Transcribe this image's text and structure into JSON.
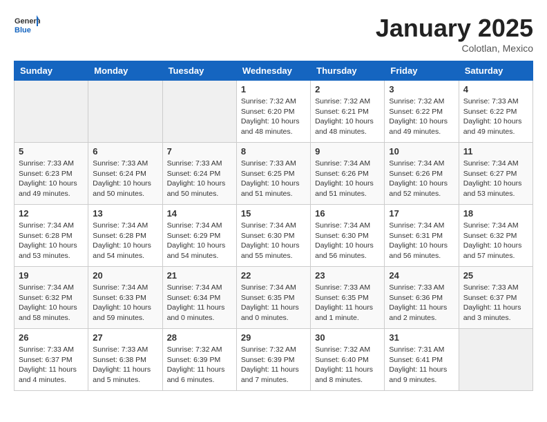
{
  "header": {
    "logo": {
      "general": "General",
      "blue": "Blue"
    },
    "month": "January 2025",
    "location": "Colotlan, Mexico"
  },
  "weekdays": [
    "Sunday",
    "Monday",
    "Tuesday",
    "Wednesday",
    "Thursday",
    "Friday",
    "Saturday"
  ],
  "weeks": [
    [
      {
        "day": "",
        "info": ""
      },
      {
        "day": "",
        "info": ""
      },
      {
        "day": "",
        "info": ""
      },
      {
        "day": "1",
        "info": "Sunrise: 7:32 AM\nSunset: 6:20 PM\nDaylight: 10 hours\nand 48 minutes."
      },
      {
        "day": "2",
        "info": "Sunrise: 7:32 AM\nSunset: 6:21 PM\nDaylight: 10 hours\nand 48 minutes."
      },
      {
        "day": "3",
        "info": "Sunrise: 7:32 AM\nSunset: 6:22 PM\nDaylight: 10 hours\nand 49 minutes."
      },
      {
        "day": "4",
        "info": "Sunrise: 7:33 AM\nSunset: 6:22 PM\nDaylight: 10 hours\nand 49 minutes."
      }
    ],
    [
      {
        "day": "5",
        "info": "Sunrise: 7:33 AM\nSunset: 6:23 PM\nDaylight: 10 hours\nand 49 minutes."
      },
      {
        "day": "6",
        "info": "Sunrise: 7:33 AM\nSunset: 6:24 PM\nDaylight: 10 hours\nand 50 minutes."
      },
      {
        "day": "7",
        "info": "Sunrise: 7:33 AM\nSunset: 6:24 PM\nDaylight: 10 hours\nand 50 minutes."
      },
      {
        "day": "8",
        "info": "Sunrise: 7:33 AM\nSunset: 6:25 PM\nDaylight: 10 hours\nand 51 minutes."
      },
      {
        "day": "9",
        "info": "Sunrise: 7:34 AM\nSunset: 6:26 PM\nDaylight: 10 hours\nand 51 minutes."
      },
      {
        "day": "10",
        "info": "Sunrise: 7:34 AM\nSunset: 6:26 PM\nDaylight: 10 hours\nand 52 minutes."
      },
      {
        "day": "11",
        "info": "Sunrise: 7:34 AM\nSunset: 6:27 PM\nDaylight: 10 hours\nand 53 minutes."
      }
    ],
    [
      {
        "day": "12",
        "info": "Sunrise: 7:34 AM\nSunset: 6:28 PM\nDaylight: 10 hours\nand 53 minutes."
      },
      {
        "day": "13",
        "info": "Sunrise: 7:34 AM\nSunset: 6:28 PM\nDaylight: 10 hours\nand 54 minutes."
      },
      {
        "day": "14",
        "info": "Sunrise: 7:34 AM\nSunset: 6:29 PM\nDaylight: 10 hours\nand 54 minutes."
      },
      {
        "day": "15",
        "info": "Sunrise: 7:34 AM\nSunset: 6:30 PM\nDaylight: 10 hours\nand 55 minutes."
      },
      {
        "day": "16",
        "info": "Sunrise: 7:34 AM\nSunset: 6:30 PM\nDaylight: 10 hours\nand 56 minutes."
      },
      {
        "day": "17",
        "info": "Sunrise: 7:34 AM\nSunset: 6:31 PM\nDaylight: 10 hours\nand 56 minutes."
      },
      {
        "day": "18",
        "info": "Sunrise: 7:34 AM\nSunset: 6:32 PM\nDaylight: 10 hours\nand 57 minutes."
      }
    ],
    [
      {
        "day": "19",
        "info": "Sunrise: 7:34 AM\nSunset: 6:32 PM\nDaylight: 10 hours\nand 58 minutes."
      },
      {
        "day": "20",
        "info": "Sunrise: 7:34 AM\nSunset: 6:33 PM\nDaylight: 10 hours\nand 59 minutes."
      },
      {
        "day": "21",
        "info": "Sunrise: 7:34 AM\nSunset: 6:34 PM\nDaylight: 11 hours\nand 0 minutes."
      },
      {
        "day": "22",
        "info": "Sunrise: 7:34 AM\nSunset: 6:35 PM\nDaylight: 11 hours\nand 0 minutes."
      },
      {
        "day": "23",
        "info": "Sunrise: 7:33 AM\nSunset: 6:35 PM\nDaylight: 11 hours\nand 1 minute."
      },
      {
        "day": "24",
        "info": "Sunrise: 7:33 AM\nSunset: 6:36 PM\nDaylight: 11 hours\nand 2 minutes."
      },
      {
        "day": "25",
        "info": "Sunrise: 7:33 AM\nSunset: 6:37 PM\nDaylight: 11 hours\nand 3 minutes."
      }
    ],
    [
      {
        "day": "26",
        "info": "Sunrise: 7:33 AM\nSunset: 6:37 PM\nDaylight: 11 hours\nand 4 minutes."
      },
      {
        "day": "27",
        "info": "Sunrise: 7:33 AM\nSunset: 6:38 PM\nDaylight: 11 hours\nand 5 minutes."
      },
      {
        "day": "28",
        "info": "Sunrise: 7:32 AM\nSunset: 6:39 PM\nDaylight: 11 hours\nand 6 minutes."
      },
      {
        "day": "29",
        "info": "Sunrise: 7:32 AM\nSunset: 6:39 PM\nDaylight: 11 hours\nand 7 minutes."
      },
      {
        "day": "30",
        "info": "Sunrise: 7:32 AM\nSunset: 6:40 PM\nDaylight: 11 hours\nand 8 minutes."
      },
      {
        "day": "31",
        "info": "Sunrise: 7:31 AM\nSunset: 6:41 PM\nDaylight: 11 hours\nand 9 minutes."
      },
      {
        "day": "",
        "info": ""
      }
    ]
  ]
}
